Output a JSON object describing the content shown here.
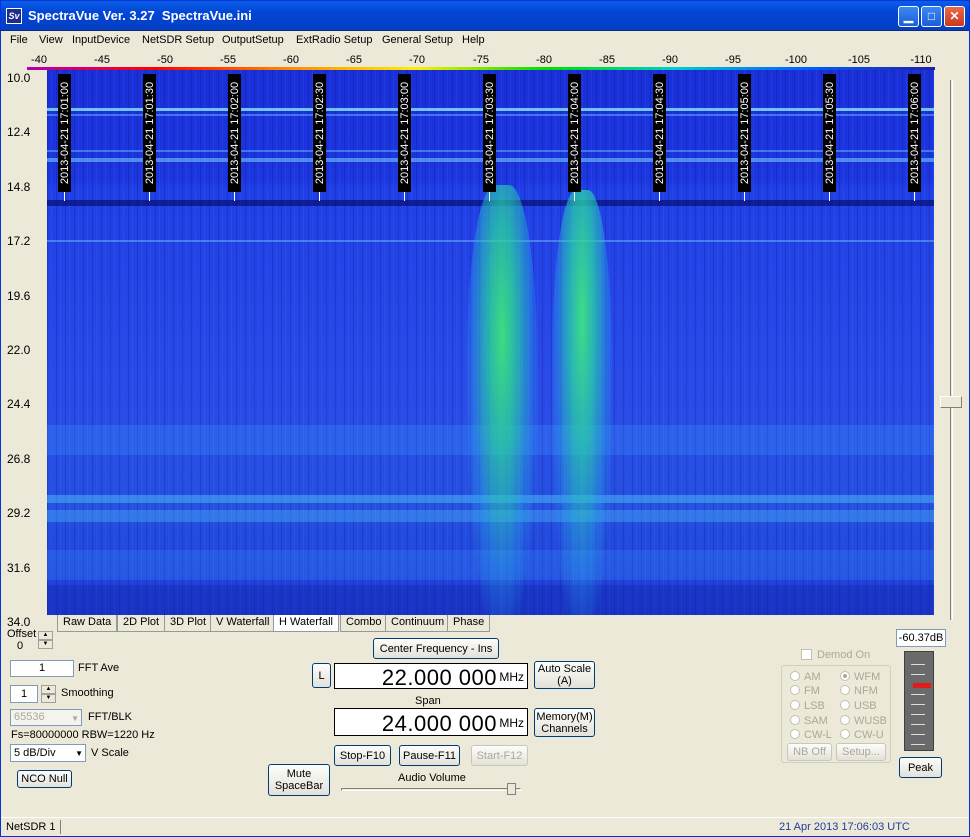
{
  "window": {
    "icon_text": "Sv",
    "title": "SpectraVue Ver. 3.27  SpectraVue.ini",
    "min_glyph": "▁",
    "max_glyph": "□",
    "close_glyph": "✕"
  },
  "menu": [
    "File",
    "View",
    "InputDevice",
    "NetSDR Setup",
    "OutputSetup",
    "ExtRadio Setup",
    "General Setup",
    "Help"
  ],
  "db_scale": [
    "-40",
    "-45",
    "-50",
    "-55",
    "-60",
    "-65",
    "-70",
    "-75",
    "-80",
    "-85",
    "-90",
    "-95",
    "-100",
    "-105",
    "-110"
  ],
  "freq_axis": [
    "10.0",
    "12.4",
    "14.8",
    "17.2",
    "19.6",
    "22.0",
    "24.4",
    "26.8",
    "29.2",
    "31.6",
    "34.0"
  ],
  "timestamps": [
    "2013-04-21 17:01:00",
    "2013-04-21 17:01:30",
    "2013-04-21 17:02:00",
    "2013-04-21 17:02:30",
    "2013-04-21 17:03:00",
    "2013-04-21 17:03:30",
    "2013-04-21 17:04:00",
    "2013-04-21 17:04:30",
    "2013-04-21 17:05:00",
    "2013-04-21 17:05:30",
    "2013-04-21 17:06:00"
  ],
  "tabs": [
    "Raw Data",
    "2D Plot",
    "3D Plot",
    "V Waterfall",
    "H Waterfall",
    "Combo",
    "Continuum",
    "Phase"
  ],
  "active_tab": "H Waterfall",
  "controls": {
    "offset_label": "Offset",
    "offset_value": "0",
    "fft_ave_value": "1",
    "fft_ave_label": "FFT Ave",
    "smoothing_value": "1",
    "smoothing_label": "Smoothing",
    "fft_blk_value": "65536",
    "fft_blk_label": "FFT/BLK",
    "fs_text": "Fs=80000000 RBW=1220 Hz",
    "vscale_value": "5 dB/Div",
    "vscale_label": "V Scale",
    "nco_null": "NCO Null",
    "mute_line1": "Mute",
    "mute_line2": "SpaceBar"
  },
  "frequency": {
    "center_button": "Center Frequency - Ins",
    "l_button": "L",
    "center_value": "22.000 000",
    "center_unit": "MHz",
    "auto_scale_line1": "Auto Scale",
    "auto_scale_line2": "(A)",
    "span_label": "Span",
    "span_value": "24.000 000",
    "span_unit": "MHz",
    "memory_line1": "Memory(M)",
    "memory_line2": "Channels",
    "stop": "Stop-F10",
    "pause": "Pause-F11",
    "start": "Start-F12",
    "audio_volume": "Audio Volume",
    "audio_volume_level": 0.95
  },
  "demod": {
    "enable_label": "Demod On",
    "modes_left": [
      "AM",
      "FM",
      "LSB",
      "SAM",
      "CW-L"
    ],
    "modes_right": [
      "WFM",
      "NFM",
      "USB",
      "WUSB",
      "CW-U"
    ],
    "selected": "WFM",
    "nb_off": "NB Off",
    "setup": "Setup..."
  },
  "meter": {
    "readout": "-60.37dB",
    "peak_button": "Peak"
  },
  "status": {
    "device": "NetSDR 1",
    "datetime": "21 Apr 2013  17:06:03 UTC"
  },
  "colors": {
    "title_blue": "#0346d6",
    "waterfall_blue": "#2040e6",
    "signal_green": "#3ce678",
    "status_date": "#1f3fa0"
  }
}
